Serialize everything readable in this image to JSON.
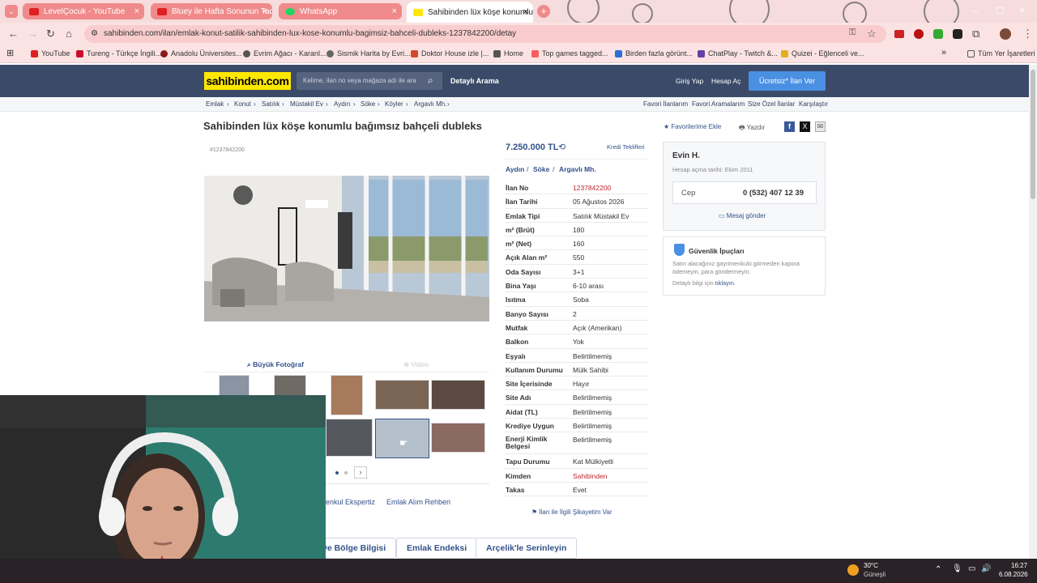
{
  "browser": {
    "tabs": [
      {
        "label": "LevelÇocuk - YouTube",
        "fav": "#e02020"
      },
      {
        "label": "Bluey ile Hafta Sonunun Tadını",
        "fav": "#e02020"
      },
      {
        "label": "WhatsApp",
        "fav": "#25d366"
      },
      {
        "label": "Sahibinden lüx köşe konumlu b",
        "fav": "#ffe800"
      }
    ],
    "url": "sahibinden.com/ilan/emlak-konut-satilik-sahibinden-lux-kose-konumlu-bagimsiz-bahceli-dubleks-1237842200/detay",
    "bookmarks": [
      {
        "label": "YouTube",
        "c": "#e02020"
      },
      {
        "label": "Tureng - Türkçe İngili...",
        "c": "#c8102e"
      },
      {
        "label": "Anadolu Üniversites...",
        "c": "#8b1a1a"
      },
      {
        "label": "Evrim Ağacı - Karanl...",
        "c": "#555"
      },
      {
        "label": "Sismik Harita by Evri...",
        "c": "#666"
      },
      {
        "label": "Doktor House izle |...",
        "c": "#d24b2b"
      },
      {
        "label": "Home",
        "c": "#555"
      },
      {
        "label": "Top games tagged...",
        "c": "#fa5c5c"
      },
      {
        "label": "Birden fazla görünt...",
        "c": "#2a6fd6"
      },
      {
        "label": "ChatPlay - Twitch &...",
        "c": "#6441a5"
      },
      {
        "label": "Quizei - Eğlenceli ve...",
        "c": "#e0b020"
      }
    ],
    "all_bookmarks": "Tüm Yer İşaretleri"
  },
  "site": {
    "logo": "sahibinden.com",
    "search_placeholder": "Kelime, ilan no veya mağaza adı ile ara",
    "detailed_search": "Detaylı Arama",
    "login": "Giriş Yap",
    "register": "Hesap Aç",
    "post_ad": "Ücretsiz* İlan Ver",
    "breadcrumb": [
      "Emlak",
      "Konut",
      "Satılık",
      "Müstakil Ev",
      "Aydın",
      "Söke",
      "Köyler",
      "Argavlı Mh."
    ],
    "top_links": [
      "Favori İlanlarım",
      "Favori Aramalarım",
      "Size Özel İlanlar",
      "Karşılaştır"
    ]
  },
  "listing": {
    "title": "Sahibinden lüx köşe konumlu bağımsız bahçeli dubleks",
    "ad_id_tag": "#1237842200",
    "price": "7.250.000 TL",
    "credit": "Kredi Teklifleri",
    "location": [
      "Aydın",
      "Söke",
      "Argavlı Mh."
    ],
    "fav_add": "Favorilerime Ekle",
    "print": "Yazdır",
    "big_photo": "Büyük Fotoğraf",
    "video": "Video",
    "specs": [
      {
        "k": "İlan No",
        "v": "1237842200",
        "red": true
      },
      {
        "k": "İlan Tarihi",
        "v": "05 Ağustos 2026"
      },
      {
        "k": "Emlak Tipi",
        "v": "Satılık Müstakil Ev"
      },
      {
        "k": "m² (Brüt)",
        "v": "180"
      },
      {
        "k": "m² (Net)",
        "v": "160"
      },
      {
        "k": "Açık Alan m²",
        "v": "550"
      },
      {
        "k": "Oda Sayısı",
        "v": "3+1"
      },
      {
        "k": "Bina Yaşı",
        "v": "6-10 arası"
      },
      {
        "k": "Isıtma",
        "v": "Soba"
      },
      {
        "k": "Banyo Sayısı",
        "v": "2"
      },
      {
        "k": "Mutfak",
        "v": "Açık (Amerikan)"
      },
      {
        "k": "Balkon",
        "v": "Yok"
      },
      {
        "k": "Eşyalı",
        "v": "Belirtilmemiş"
      },
      {
        "k": "Kullanım Durumu",
        "v": "Mülk Sahibi"
      },
      {
        "k": "Site İçerisinde",
        "v": "Hayır"
      },
      {
        "k": "Site Adı",
        "v": "Belirtilmemiş"
      },
      {
        "k": "Aidat (TL)",
        "v": "Belirtilmemiş"
      },
      {
        "k": "Krediye Uygun",
        "v": "Belirtilmemiş"
      },
      {
        "k": "Enerji Kimlik Belgesi",
        "v": "Belirtilmemiş"
      },
      {
        "k": "Tapu Durumu",
        "v": "Kat Mülkiyetli"
      },
      {
        "k": "Kimden",
        "v": "Sahibinden",
        "red": true
      },
      {
        "k": "Takas",
        "v": "Evet"
      }
    ],
    "complaint": "İlan ile İlgili Şikayetim Var",
    "bottom_links": [
      "enkul Ekspertiz",
      "Emlak Alım Rehberi"
    ],
    "bottom_tabs": [
      "ve Bölge Bilgisi",
      "Emlak Endeksi",
      "Arçelik'le Serinleyin"
    ]
  },
  "seller": {
    "name": "Evin H.",
    "since": "Hesap açma tarihi: Ekim 2011",
    "phone_label": "Cep",
    "phone": "0 (532) 407 12 39",
    "message": "Mesaj gönder"
  },
  "security": {
    "title": "Güvenlik İpuçları",
    "text": "Satın alacağınız gayrimenkulü görmeden kapora ödemeyin, para göndermeyin.",
    "more_prefix": "Detaylı bilgi için",
    "more_link": "tıklayın."
  },
  "taskbar": {
    "temp": "30°C",
    "weather": "Güneşli",
    "time": "16:27",
    "date": "6.08.2026"
  }
}
